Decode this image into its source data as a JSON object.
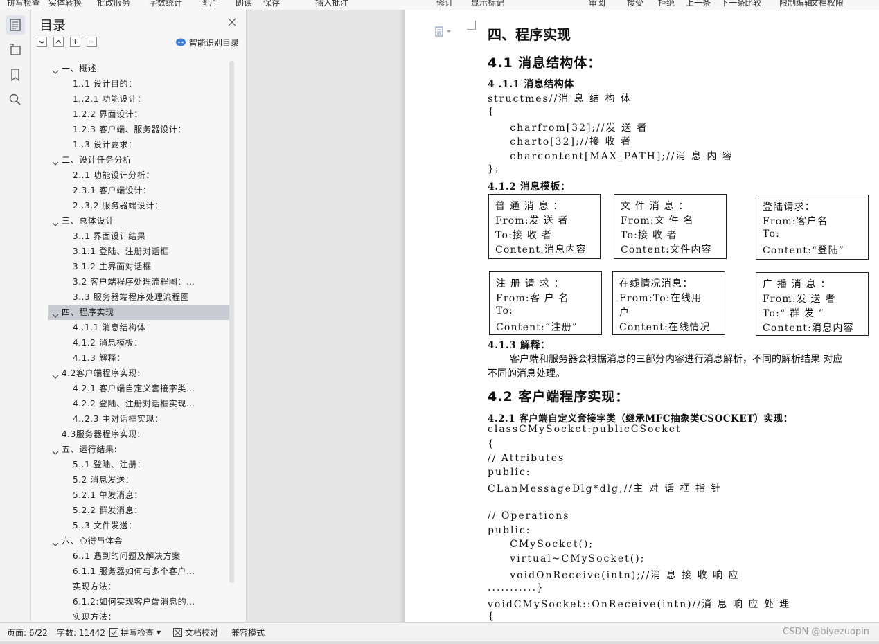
{
  "toolbar_fragments": [
    "拼写检查",
    "实体转换",
    "批改服务",
    "字数统计",
    "图片",
    "朗读",
    "保存",
    "插入批注",
    "修订",
    "显示标记",
    "审阅",
    "接受",
    "拒绝",
    "上一条",
    "下一条",
    "比较",
    "限制编辑",
    "文档权限"
  ],
  "toc": {
    "title": "目录",
    "smart_label": "智能识别目录",
    "items": [
      {
        "text": "一、概述",
        "level": 0,
        "caret": true
      },
      {
        "text": "1..1 设计目的：",
        "level": 1
      },
      {
        "text": "1..2.1 功能设计：",
        "level": 1
      },
      {
        "text": "1.2.2 界面设计：",
        "level": 1
      },
      {
        "text": "1.2.3 客户端、服务器设计：",
        "level": 1
      },
      {
        "text": "1..3 设计要求：",
        "level": 1
      },
      {
        "text": "二、设计任务分析",
        "level": 0,
        "caret": true
      },
      {
        "text": "2..1 功能设计分析：",
        "level": 1
      },
      {
        "text": "2.3.1 客户端设计：",
        "level": 1
      },
      {
        "text": "2..3.2 服务器端设计：",
        "level": 1
      },
      {
        "text": "三、总体设计",
        "level": 0,
        "caret": true
      },
      {
        "text": "3..1 界面设计结果",
        "level": 1
      },
      {
        "text": "3.1.1 登陆、注册对话框",
        "level": 1
      },
      {
        "text": "3.1.2 主界面对话框",
        "level": 1
      },
      {
        "text": "3.2 客户端程序处理流程图：…",
        "level": 1
      },
      {
        "text": "3..3 服务器端程序处理流程图",
        "level": 1
      },
      {
        "text": "四、程序实现",
        "level": 0,
        "caret": true,
        "selected": true
      },
      {
        "text": "4..1.1 消息结构体",
        "level": 1
      },
      {
        "text": "4.1.2 消息模板：",
        "level": 1
      },
      {
        "text": "4.1.3 解释：",
        "level": 1
      },
      {
        "text": "4.2客户端程序实现:",
        "level": 0,
        "caret": true
      },
      {
        "text": "4.2.1 客户端自定义套接字类…",
        "level": 1
      },
      {
        "text": "4.2.2 登陆、注册对话框实现…",
        "level": 1
      },
      {
        "text": "4..2.3 主对话框实现：",
        "level": 1
      },
      {
        "text": "4.3服务器程序实现:",
        "level": 0,
        "caret": false
      },
      {
        "text": "五、运行结果:",
        "level": 0,
        "caret": true
      },
      {
        "text": "5..1 登陆、注册：",
        "level": 1
      },
      {
        "text": "5.2 消息发送：",
        "level": 1
      },
      {
        "text": "5.2.1 单发消息：",
        "level": 1
      },
      {
        "text": "5.2.2 群发消息：",
        "level": 1
      },
      {
        "text": "5..3 文件发送：",
        "level": 1
      },
      {
        "text": "六、心得与体会",
        "level": 0,
        "caret": true
      },
      {
        "text": "6..1 遇到的问题及解决方案",
        "level": 1
      },
      {
        "text": "6.1.1 服务器如何与多个客户…",
        "level": 1
      },
      {
        "text": "实现方法：",
        "level": 1
      },
      {
        "text": "6.1.2:如何实现客户端消息的…",
        "level": 1
      },
      {
        "text": "实现方法：",
        "level": 1
      }
    ]
  },
  "doc": {
    "chapter": "四、程序实现",
    "sec41": "4.1 消息结构体：",
    "sub411": "4 .1.1 消息结构体",
    "code1": [
      "structmes//消 息 结 构 体",
      "{",
      "    charfrom[32];//发 送 者",
      "    charto[32];//接 收 者",
      "    charcontent[MAX_PATH];//消 息 内 容",
      "};"
    ],
    "sub412": "4.1.2 消息模板：",
    "boxes": [
      [
        "普 通 消 息 ：",
        "From:发 送 者",
        "To:接 收 者",
        "Content:消息内容"
      ],
      [
        "文 件 消 息 ：",
        "From:文 件 名",
        "To:接 收 者",
        "Content:文件内容"
      ],
      [
        "登陆请求：",
        "From:客户名",
        "To:",
        "Content:“登陆”"
      ],
      [
        "注 册 请 求 ：",
        "From:客 户 名",
        "To:",
        "Content:“注册”"
      ],
      [
        "在线情况消息：",
        "From:To:在线用",
        "户",
        "Content:在线情况"
      ],
      [
        "广 播 消 息 ：",
        "From:发 送 者",
        "To:“ 群 发 ”",
        "Content:消息内容"
      ]
    ],
    "sub413": "4.1.3 解释：",
    "para1": "客户端和服务器会根据消息的三部分内容进行消息解析，不同的解析结果 对应",
    "para2": "不同的消息处理。",
    "sec42": "4.2 客户端程序实现：",
    "sub421": "4.2.1 客户端自定义套接字类（继承MFC抽象类CSOCKET）实现：",
    "code2": [
      "classCMySocket:publicCSocket",
      "{",
      "// Attributes",
      "public:",
      "CLanMessageDlg*dlg;//主 对 话 框 指 针",
      "",
      "// Operations",
      "public:",
      "    CMySocket();",
      "    virtual~CMySocket();",
      "    voidOnReceive(intn);//消 息 接 收 响 应",
      "...........}",
      "voidCMySocket::OnReceive(intn)//消 息 响 应 处 理",
      "{"
    ]
  },
  "status": {
    "page": "页面: 6/22",
    "words": "字数: 11442",
    "spell": "拼写检查",
    "proof": "文档校对",
    "compat": "兼容模式",
    "watermark": "CSDN @biyezuopin"
  },
  "icons": [
    "toc-icon",
    "outline-icon",
    "bookmark-icon",
    "search-icon",
    "close-icon",
    "collapse-icon",
    "expand-icon",
    "plus-icon",
    "minus-icon",
    "smart-recognize-icon",
    "doc-menu-icon",
    "spell-check-icon",
    "proofread-icon"
  ]
}
